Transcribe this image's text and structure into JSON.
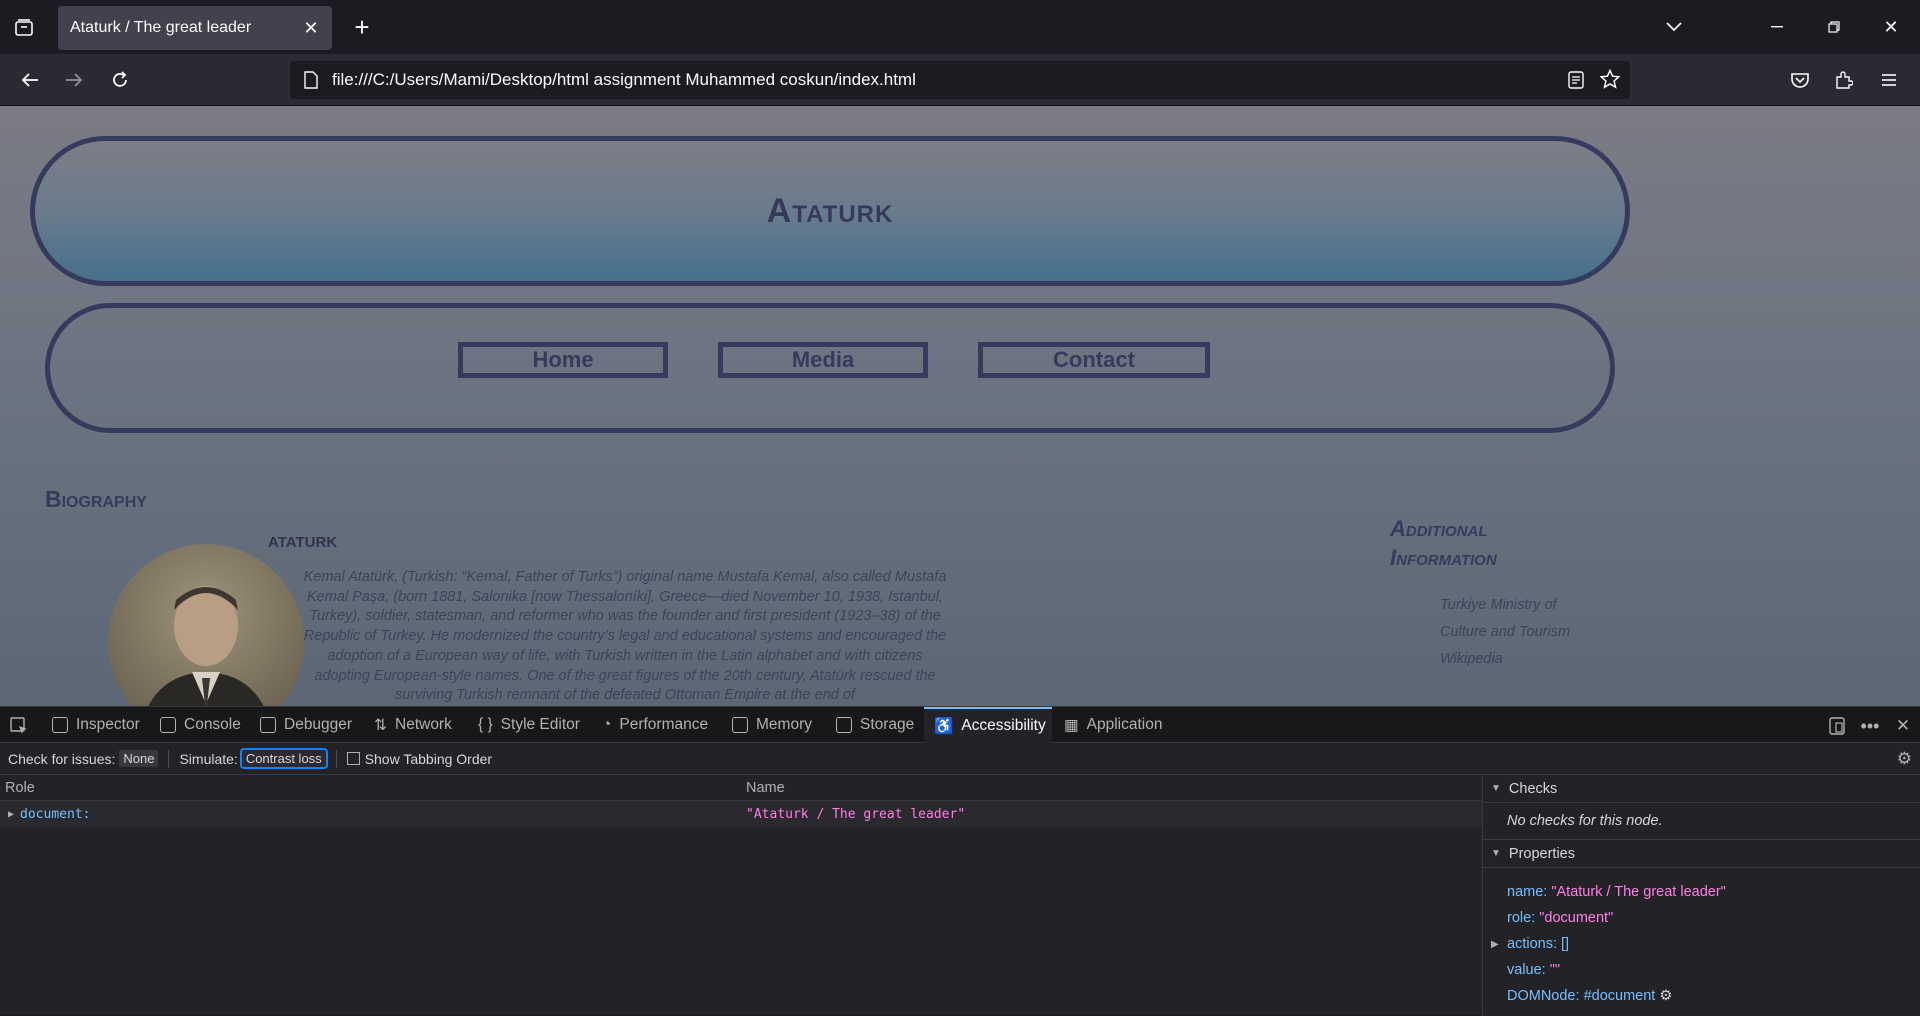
{
  "browser": {
    "tab_title": "Ataturk / The great leader",
    "url": "file:///C:/Users/Mami/Desktop/html assignment Muhammed coskun/index.html"
  },
  "page": {
    "header_title": "Ataturk",
    "nav": [
      "Home",
      "Media",
      "Contact"
    ],
    "bio_title": "Biography",
    "bio_name": "ATATURK",
    "bio_text": "Kemal Atatürk, (Turkish: “Kemal, Father of Turks”) original name Mustafa Kemal, also called Mustafa Kemal Paşa, (born 1881, Salonika [now Thessaloníki], Greece—died November 10, 1938, Istanbul, Turkey), soldier, statesman, and reformer who was the founder and first president (1923–38) of the Republic of Turkey. He modernized the country’s legal and educational systems and encouraged the adoption of a European way of life, with Turkish written in the Latin alphabet and with citizens adopting European-style names. One of the great figures of the 20th century, Atatürk rescued the surviving Turkish remnant of the defeated Ottoman Empire at the end of",
    "additional_title_1": "Additional",
    "additional_title_2": "Information",
    "links": [
      "Turkiye Ministry of",
      "Culture and Tourism",
      "Wikipedia"
    ]
  },
  "devtools": {
    "tabs": [
      "Inspector",
      "Console",
      "Debugger",
      "Network",
      "Style Editor",
      "Performance",
      "Memory",
      "Storage",
      "Accessibility",
      "Application"
    ],
    "active_tab": "Accessibility",
    "check_label": "Check for issues:",
    "check_value": "None",
    "simulate_label": "Simulate:",
    "simulate_value": "Contrast loss",
    "tabbing_label": "Show Tabbing Order",
    "col_role": "Role",
    "col_name": "Name",
    "row_role": "document:",
    "row_name": "\"Ataturk / The great leader\"",
    "checks_title": "Checks",
    "checks_text": "No checks for this node.",
    "properties_title": "Properties",
    "properties": [
      {
        "key": "name:",
        "value": "\"Ataturk / The great leader\""
      },
      {
        "key": "role:",
        "value": "\"document\""
      },
      {
        "key": "actions:",
        "value": "[]"
      },
      {
        "key": "value:",
        "value": "\"\""
      },
      {
        "key": "DOMNode:",
        "value": "#document"
      }
    ]
  }
}
